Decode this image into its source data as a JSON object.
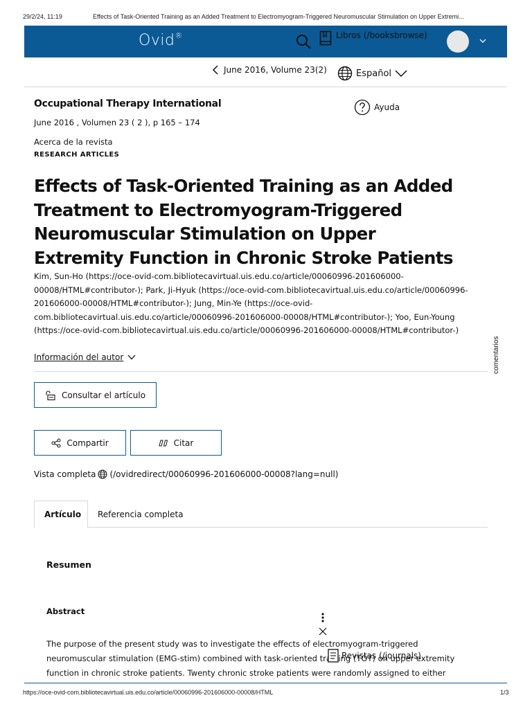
{
  "print_header": {
    "date": "29/2/24, 11:19",
    "title": "Effects of Task-Oriented Training as an Added Treatment to Electromyogram-Triggered Neuromuscular Stimulation on Upper Extremi..."
  },
  "topbar": {
    "logo": "Ovid",
    "logo_mark": "®",
    "books_link": "Libros (/booksbrowse)",
    "icons": [
      "search-icon",
      "book-icon",
      "avatar",
      "chevron-down-icon"
    ],
    "bg_color": "#0b5a96"
  },
  "issue_nav": {
    "label": "June 2016, Volume 23(2)",
    "language": "Español"
  },
  "journal": {
    "name": "Occupational Therapy International",
    "meta": "June 2016 , Volumen 23 ( 2 ), p 165 – 174",
    "about": "Acerca de la revista",
    "section": "RESEARCH ARTICLES",
    "help": "Ayuda"
  },
  "article": {
    "title": "Effects of Task-Oriented Training as an Added Treatment to Electromyogram-Triggered Neuromuscular Stimulation on Upper Extremity Function in Chronic Stroke Patients",
    "authors": "Kim, Sun-Ho (https://oce-ovid-com.bibliotecavirtual.uis.edu.co/article/00060996-201606000-00008/HTML#contributor-); Park, Ji-Hyuk (https://oce-ovid-com.bibliotecavirtual.uis.edu.co/article/00060996-201606000-00008/HTML#contributor-); Jung, Min-Ye (https://oce-ovid-com.bibliotecavirtual.uis.edu.co/article/00060996-201606000-00008/HTML#contributor-); Yoo, Eun-Young (https://oce-ovid-com.bibliotecavirtual.uis.edu.co/article/00060996-201606000-00008/HTML#contributor-)",
    "author_info": "Información del autor"
  },
  "side_tab": {
    "comments": "comentarios"
  },
  "actions": {
    "consult": "Consultar el artículo",
    "share": "Compartir",
    "cite": "Citar"
  },
  "full_view": {
    "label": "Vista completa",
    "link": "(/ovidredirect/00060996-201606000-00008?lang=null)"
  },
  "tabs": [
    {
      "label": "Artículo",
      "active": true
    },
    {
      "label": "Referencia completa",
      "active": false
    }
  ],
  "content": {
    "resumen": "Resumen",
    "abstract_heading": "Abstract",
    "abstract_text": "The purpose of the present study was to investigate the effects of electromyogram-triggered neuromuscular stimulation (EMG-stim) combined with task-oriented training (TOT) on upper extremity function in chronic stroke patients. Twenty chronic stroke patients were randomly assigned to either"
  },
  "floating": {
    "journals": "Revistas (/journals)"
  },
  "print_footer": {
    "url": "https://oce-ovid-com.bibliotecavirtual.uis.edu.co/article/00060996-201606000-00008/HTML",
    "page": "1/3"
  }
}
